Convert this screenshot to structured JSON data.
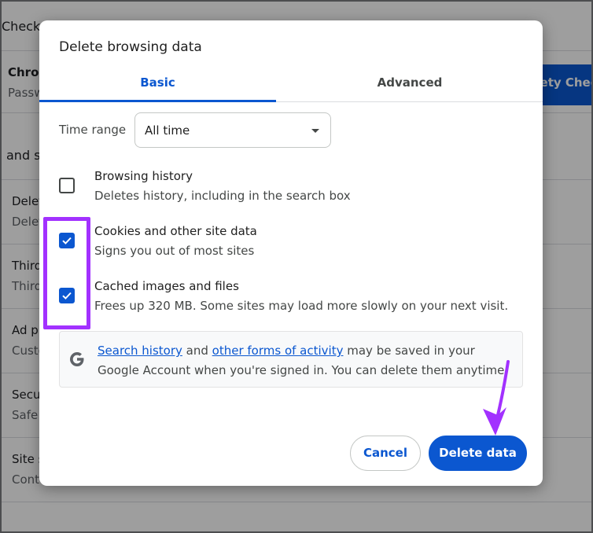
{
  "background": {
    "title": "Check",
    "card_title": "Chrom",
    "card_sub": "Passw",
    "card_button": "fety Check",
    "section": "and s",
    "rows": [
      {
        "l1": "Delet",
        "l2": "Delet"
      },
      {
        "l1": "Third",
        "l2": "Third"
      },
      {
        "l1": "Ad p",
        "l2": "Custo"
      },
      {
        "l1": "Secu",
        "l2": "Safe"
      },
      {
        "l1": "Site s",
        "l2": "Cont"
      }
    ]
  },
  "dialog": {
    "title": "Delete browsing data",
    "tabs": [
      {
        "label": "Basic",
        "active": true
      },
      {
        "label": "Advanced",
        "active": false
      }
    ],
    "time_range": {
      "label": "Time range",
      "value": "All time"
    },
    "options": [
      {
        "title": "Browsing history",
        "desc": "Deletes history, including in the search box",
        "checked": false
      },
      {
        "title": "Cookies and other site data",
        "desc": "Signs you out of most sites",
        "checked": true
      },
      {
        "title": "Cached images and files",
        "desc": "Frees up 320 MB. Some sites may load more slowly on your next visit.",
        "checked": true
      }
    ],
    "info": {
      "link1": "Search history",
      "text1": " and ",
      "link2": "other forms of activity",
      "text2": " may be saved in your Google Account when you're signed in. You can delete them anytime."
    },
    "buttons": {
      "cancel": "Cancel",
      "delete": "Delete data"
    }
  },
  "colors": {
    "accent": "#0b57d0",
    "annotation": "#a231ff"
  }
}
